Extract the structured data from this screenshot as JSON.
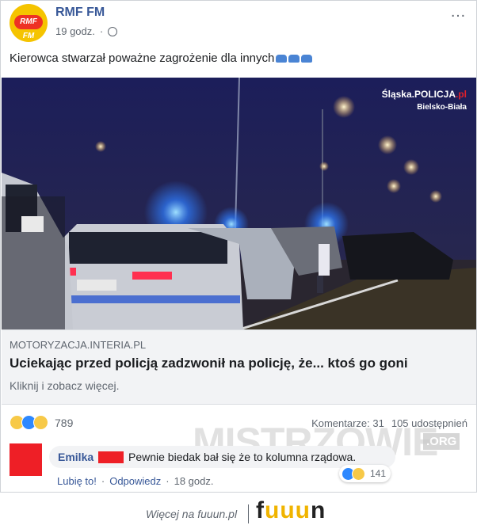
{
  "post": {
    "author": "RMF FM",
    "avatar_logo": "RMF FM",
    "time": "19 godz.",
    "time_separator": "·",
    "more_icon": "…",
    "message": "Kierowca stwarzał poważne zagrożenie dla innych",
    "message_emoji": "police-car-emoji"
  },
  "photo": {
    "watermark_main": "Śląska.POLICJA",
    "watermark_main_suffix": ".pl",
    "watermark_sub": "Bielsko-Biała"
  },
  "link": {
    "domain": "MOTORYZACJA.INTERIA.PL",
    "headline": "Uciekając przed policją zadzwonił na policję, że... ktoś go goni",
    "subline": "Kliknij i zobacz więcej."
  },
  "stats": {
    "reaction_count": "789",
    "comments": "Komentarze: 31",
    "shares": "105 udostępnień"
  },
  "overlay": {
    "mistrzowie": "MISTRZOWIE",
    "org": ".ORG"
  },
  "comment": {
    "author": "Emilka",
    "text": "Pewnie biedak bał się że to kolumna rządowa.",
    "reaction_count": "141",
    "like_label": "Lubię to!",
    "separator": "·",
    "reply_label": "Odpowiedz",
    "time": "18 godz."
  },
  "footer": {
    "more_label": "Więcej na fuuun.pl",
    "brand": "fuuun"
  },
  "colors": {
    "link_blue": "#385898",
    "accent_red": "#ee1f26",
    "rmf_yellow": "#f5c400",
    "fuuun_yellow": "#f0b400"
  }
}
